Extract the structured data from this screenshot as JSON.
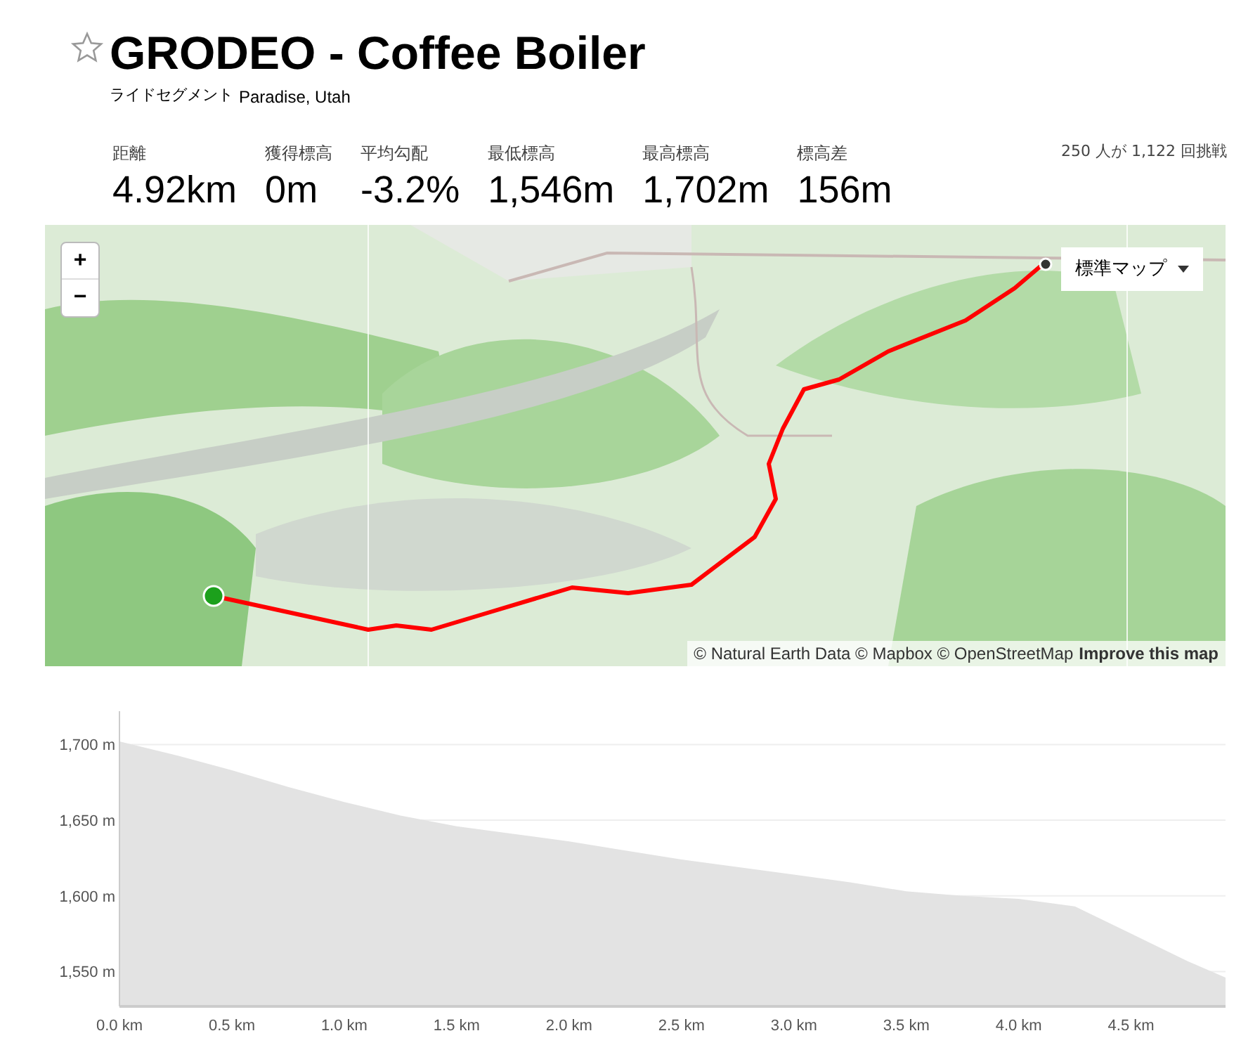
{
  "header": {
    "title": "GRODEO - Coffee Boiler",
    "type_label": "ライドセグメント",
    "location": "Paradise, Utah"
  },
  "stats": [
    {
      "label": "距離",
      "value": "4.92km"
    },
    {
      "label": "獲得標高",
      "value": "0m"
    },
    {
      "label": "平均勾配",
      "value": "-3.2%"
    },
    {
      "label": "最低標高",
      "value": "1,546m"
    },
    {
      "label": "最高標高",
      "value": "1,702m"
    },
    {
      "label": "標高差",
      "value": "156m"
    }
  ],
  "attempts": "250 人が 1,122 回挑戦",
  "map": {
    "kind": "picture",
    "zoom_in": "+",
    "zoom_out": "−",
    "map_type": "標準マップ",
    "attribution": "© Natural Earth Data © Mapbox © OpenStreetMap",
    "improve_link": "Improve this map"
  },
  "elevation": {
    "chart_data": {
      "type": "area",
      "x": [
        0,
        0.25,
        0.5,
        0.75,
        1.0,
        1.25,
        1.5,
        1.75,
        2.0,
        2.25,
        2.5,
        2.75,
        3.0,
        3.25,
        3.5,
        3.75,
        4.0,
        4.25,
        4.5,
        4.75,
        4.92
      ],
      "grid": true,
      "series": [
        {
          "color": "#e3e3e3",
          "values": [
            1702,
            1693,
            1683,
            1672,
            1662,
            1653,
            1646,
            1641,
            1636,
            1630,
            1624,
            1619,
            1614,
            1609,
            1603,
            1600,
            1598,
            1593,
            1575,
            1557,
            1546
          ]
        }
      ],
      "xlim": [
        0,
        4.92
      ],
      "ylim": [
        1527,
        1722
      ],
      "xticks": [
        {
          "value": 0,
          "label": "0.0 km"
        },
        {
          "value": 0.5,
          "label": "0.5 km"
        },
        {
          "value": 1,
          "label": "1.0 km"
        },
        {
          "value": 1.5,
          "label": "1.5 km"
        },
        {
          "value": 2,
          "label": "2.0 km"
        },
        {
          "value": 2.5,
          "label": "2.5 km"
        },
        {
          "value": 3,
          "label": "3.0 km"
        },
        {
          "value": 3.5,
          "label": "3.5 km"
        },
        {
          "value": 4,
          "label": "4.0 km"
        },
        {
          "value": 4.5,
          "label": "4.5 km"
        }
      ],
      "yticks": [
        {
          "value": 1550,
          "label": "1,550 m"
        },
        {
          "value": 1600,
          "label": "1,600 m"
        },
        {
          "value": 1650,
          "label": "1,650 m"
        },
        {
          "value": 1700,
          "label": "1,700 m"
        }
      ]
    }
  }
}
